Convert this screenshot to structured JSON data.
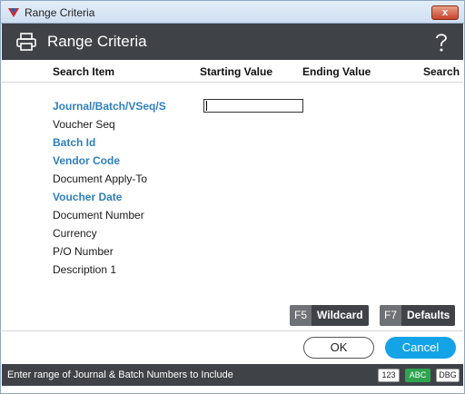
{
  "window": {
    "title": "Range Criteria",
    "close_label": "x"
  },
  "header": {
    "title": "Range Criteria",
    "icon": "printer-icon",
    "help_icon": "question-icon"
  },
  "columns": {
    "search_item": "Search Item",
    "starting_value": "Starting Value",
    "ending_value": "Ending Value",
    "search": "Search"
  },
  "rows": [
    {
      "label": "Journal/Batch/VSeq/S",
      "active": true
    },
    {
      "label": "Voucher Seq",
      "active": false
    },
    {
      "label": "Batch Id",
      "active": true
    },
    {
      "label": "Vendor Code",
      "active": true
    },
    {
      "label": "Document Apply-To",
      "active": false
    },
    {
      "label": "Voucher Date",
      "active": true
    },
    {
      "label": "Document Number",
      "active": false
    },
    {
      "label": "Currency",
      "active": false
    },
    {
      "label": "P/O Number",
      "active": false
    },
    {
      "label": "Description 1",
      "active": false
    }
  ],
  "starting_input": {
    "value": ""
  },
  "fkeys": {
    "wildcard": {
      "key": "F5",
      "label": "Wildcard"
    },
    "defaults": {
      "key": "F7",
      "label": "Defaults"
    }
  },
  "buttons": {
    "ok": "OK",
    "cancel": "Cancel"
  },
  "status": {
    "message": "Enter range of Journal & Batch Numbers to Include",
    "badges": [
      "123",
      "ABC",
      "DBG"
    ]
  },
  "colors": {
    "header_bg": "#3f4347",
    "accent_blue": "#2f7fbf",
    "cancel_bg": "#14a3e6",
    "abc_green": "#2ea44f"
  }
}
